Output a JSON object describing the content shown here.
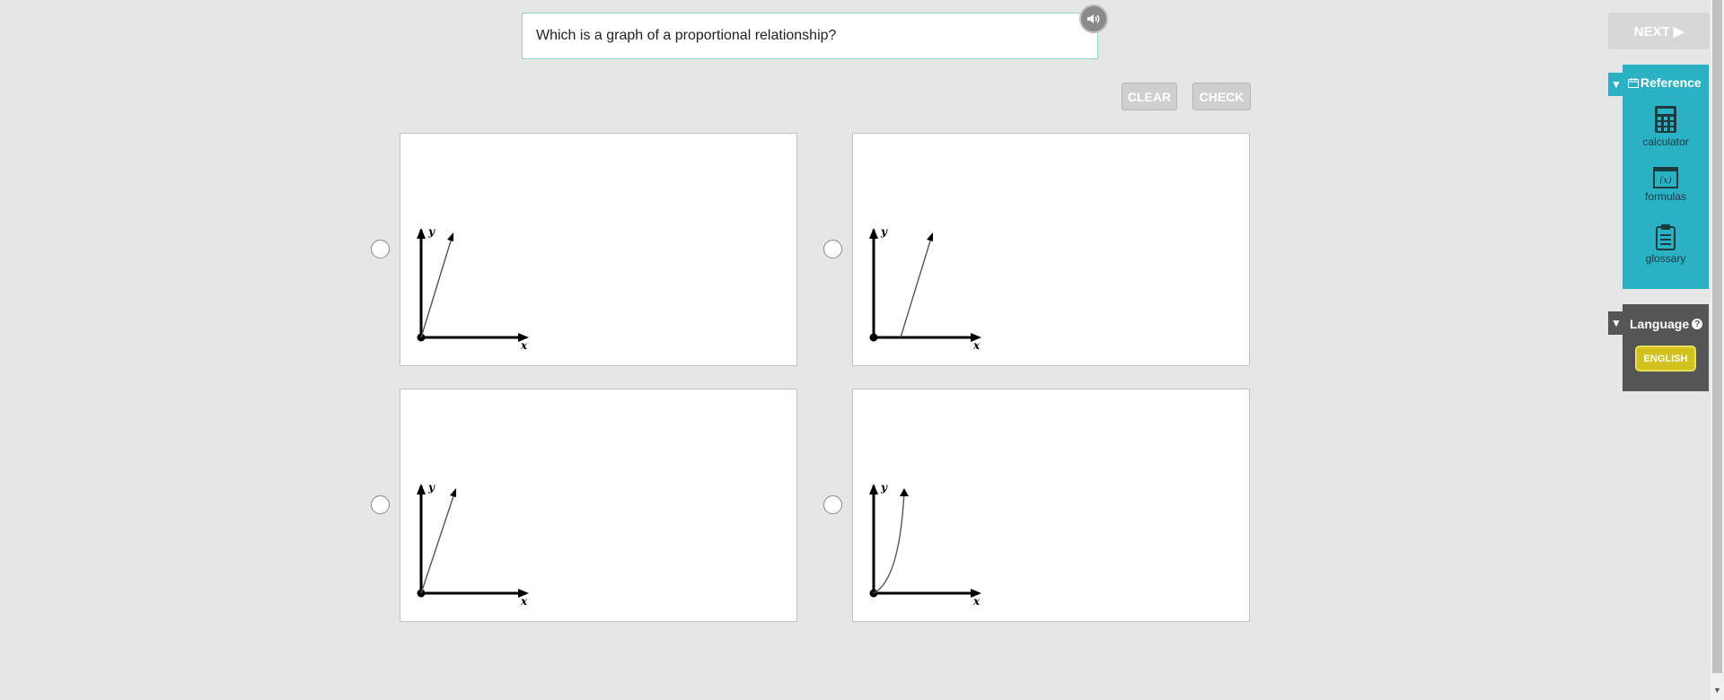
{
  "question": {
    "text": "Which is a graph of a proportional relationship?"
  },
  "toolbar": {
    "audio_icon": "speaker-icon",
    "clear_label": "CLEAR",
    "check_label": "CHECK"
  },
  "next": {
    "label": "NEXT ▶"
  },
  "reference": {
    "title": "Reference",
    "tools": [
      {
        "label": "calculator",
        "icon": "calculator-icon"
      },
      {
        "label": "formulas",
        "icon": "formulas-icon"
      },
      {
        "label": "glossary",
        "icon": "clipboard-icon"
      }
    ]
  },
  "language": {
    "title": "Language",
    "option_label": "ENGLISH"
  },
  "options": [
    {
      "graph": "line-through-origin-steep",
      "x_label": "x",
      "y_label": "y",
      "selected": false
    },
    {
      "graph": "line-with-positive-x-intercept",
      "x_label": "x",
      "y_label": "y",
      "selected": false
    },
    {
      "graph": "line-through-origin-less-steep",
      "x_label": "x",
      "y_label": "y",
      "selected": false
    },
    {
      "graph": "curve-through-origin",
      "x_label": "x",
      "y_label": "y",
      "selected": false
    }
  ],
  "colors": {
    "accent": "#2bb1c4",
    "language_panel": "#555555",
    "english_button": "#d4c21c"
  }
}
